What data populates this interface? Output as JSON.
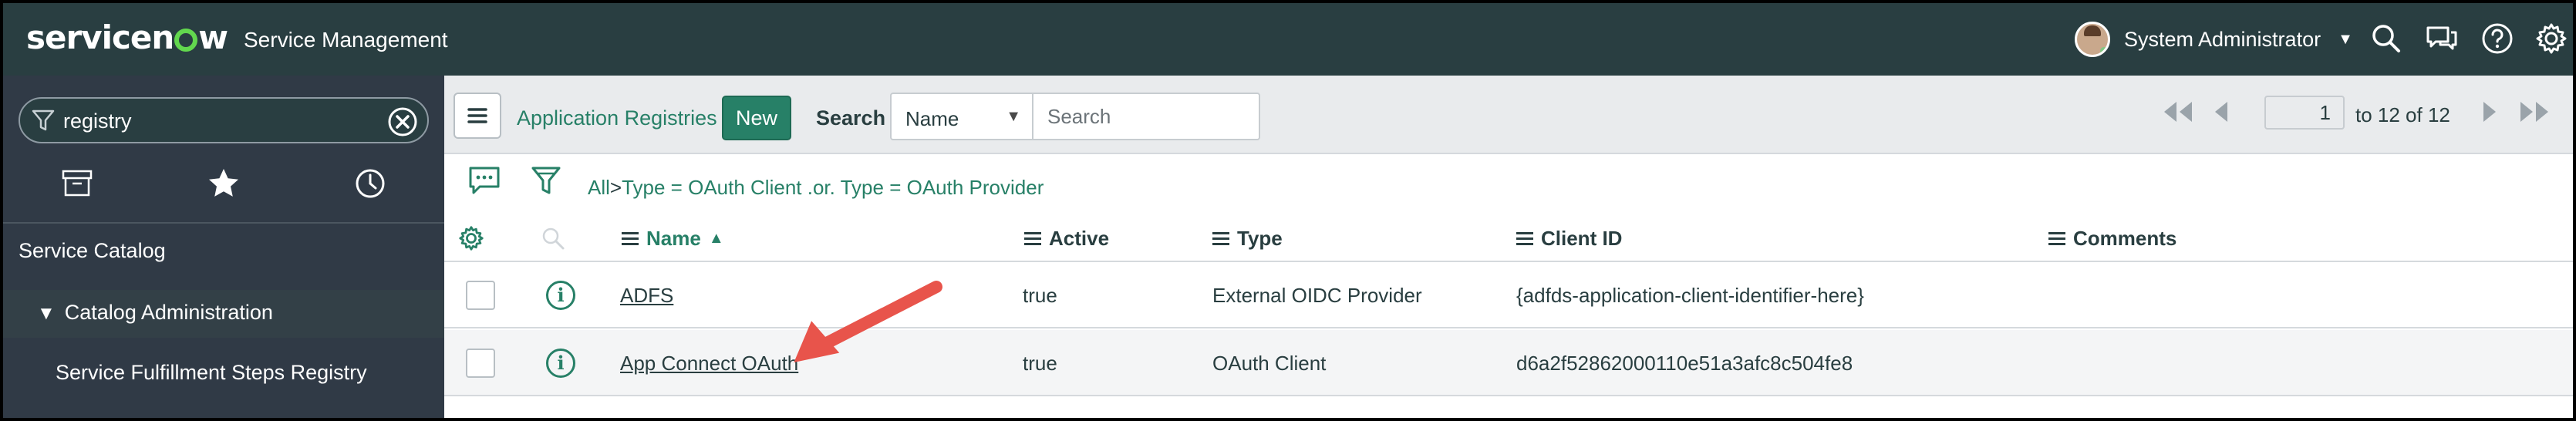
{
  "header": {
    "logo_text_1": "servicen",
    "logo_text_2": "w",
    "product": "Service Management",
    "user_name": "System Administrator",
    "icons": [
      "search-icon",
      "chat-icon",
      "help-icon",
      "gear-icon"
    ]
  },
  "sidebar": {
    "filter_value": "registry",
    "tabs": [
      "archive-icon",
      "star-icon",
      "history-icon"
    ],
    "items": [
      {
        "label": "Service Catalog"
      },
      {
        "label": "Catalog Administration"
      },
      {
        "label": "Service Fulfillment Steps Registry"
      }
    ]
  },
  "list": {
    "title": "Application Registries",
    "new_label": "New",
    "search_label": "Search",
    "search_field": "Name",
    "search_placeholder": "Search",
    "page_value": "1",
    "page_range": "to 12 of 12",
    "breadcrumb_all": "All",
    "breadcrumb_sep": ">",
    "breadcrumb_filter": "Type = OAuth Client .or. Type = OAuth Provider",
    "columns": [
      "Name",
      "Active",
      "Type",
      "Client ID",
      "Comments"
    ],
    "rows": [
      {
        "name": "ADFS",
        "active": "true",
        "type": "External OIDC Provider",
        "client_id": "{adfds-application-client-identifier-here}",
        "comments": ""
      },
      {
        "name": "App Connect OAuth",
        "active": "true",
        "type": "OAuth Client",
        "client_id": "d6a2f52862000110e51a3afc8c504fe8",
        "comments": ""
      }
    ]
  },
  "colors": {
    "topbar": "#293e41",
    "sidebar": "#303a46",
    "accent": "#278067",
    "annotation_arrow": "#e8544b"
  }
}
